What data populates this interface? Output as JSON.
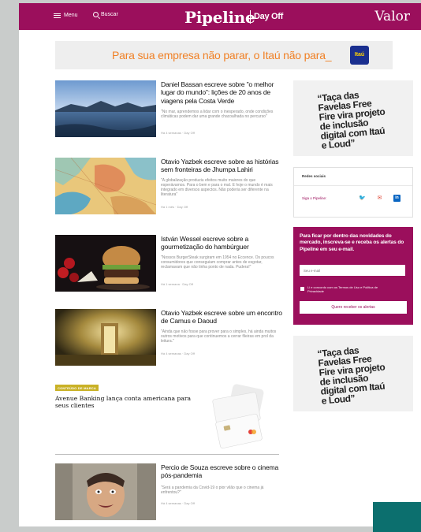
{
  "header": {
    "menu_label": "Menu",
    "search_label": "Buscar",
    "brand": "Pipeline",
    "brand_sub": "Day Off",
    "publisher": "Valor",
    "brand_color": "#9b0f5c"
  },
  "banner_ad": {
    "text": "Para sua empresa não parar, o Itaú não para_",
    "logo": "Itaú",
    "text_color": "#f08025"
  },
  "articles": [
    {
      "title": "Daniel Bassan escreve sobre \"o melhor lugar do mundo\": lições de 20 anos de viagens pela Costa Verde",
      "excerpt": "\"No mar, aprendemos a lidar com o inesperado, onde condições climáticas podem dar uma grande chacoalhada no percurso\"",
      "meta": "Há 4 semanas · Day Off",
      "image": "sea-coast"
    },
    {
      "title": "Otavio Yazbek escreve sobre as histórias sem fronteiras de Jhumpa Lahiri",
      "excerpt": "\"A globalização produziu efeitos muito maiores do que esperávamos. Para o bem e para o mal. E hoje o mundo é mais integrado em diversos aspectos. Não poderia ser diferente na literatura\"",
      "meta": "Há 1 mês · Day Off",
      "image": "world-map"
    },
    {
      "title": "István Wessel escreve sobre a gourmetização do hambúrguer",
      "excerpt": "\"Nossos BurgerSteak surgiram em 1954 no Eccence. Os poucos consumidores que conseguiam comprar antes de esgotar, reclamavam que não tinha ponto de nada. Pudera!\"",
      "meta": "Há 1 semana · Day Off",
      "image": "hamburger"
    },
    {
      "title": "Otavio Yazbek escreve sobre um encontro de Camus e Daoud",
      "excerpt": "\"Ainda que não fosse para prover para o simples, há ainda muitos outros motivos para que continuemos a cerrar fileiras em prol da leitura.\"",
      "meta": "Há 4 semanas · Day Off",
      "image": "book"
    },
    {
      "title": "Percio de Souza escreve sobre o cinema pós-pandemia",
      "excerpt": "\"Será a pandemia da Covid-19 o pior vilão que o cinema já enfrentou?\"",
      "meta": "Há 4 semanas · Day Off",
      "image": "film-still"
    }
  ],
  "sponsored": {
    "tag": "CONTEÚDO DE MARCA",
    "title": "Avenue Banking lança conta americana para seus clientes"
  },
  "side_ad": {
    "text": "“Taça das Favelas Free Fire vira projeto de inclusão digital com Itaú e Loud”"
  },
  "social": {
    "title": "Redes sociais",
    "follow_label": "Siga o Pipeline:",
    "icons": [
      "twitter-icon",
      "mail-icon",
      "linkedin-icon"
    ]
  },
  "newsletter": {
    "text": "Para ficar por dentro das novidades do mercado, inscreva-se e receba os alertas do Pipeline em seu e-mail.",
    "email_placeholder": "Seu e-mail",
    "consent": "Li e concordo com os Termos de Uso e Política de Privacidade",
    "button_label": "Quero receber os alertas"
  }
}
